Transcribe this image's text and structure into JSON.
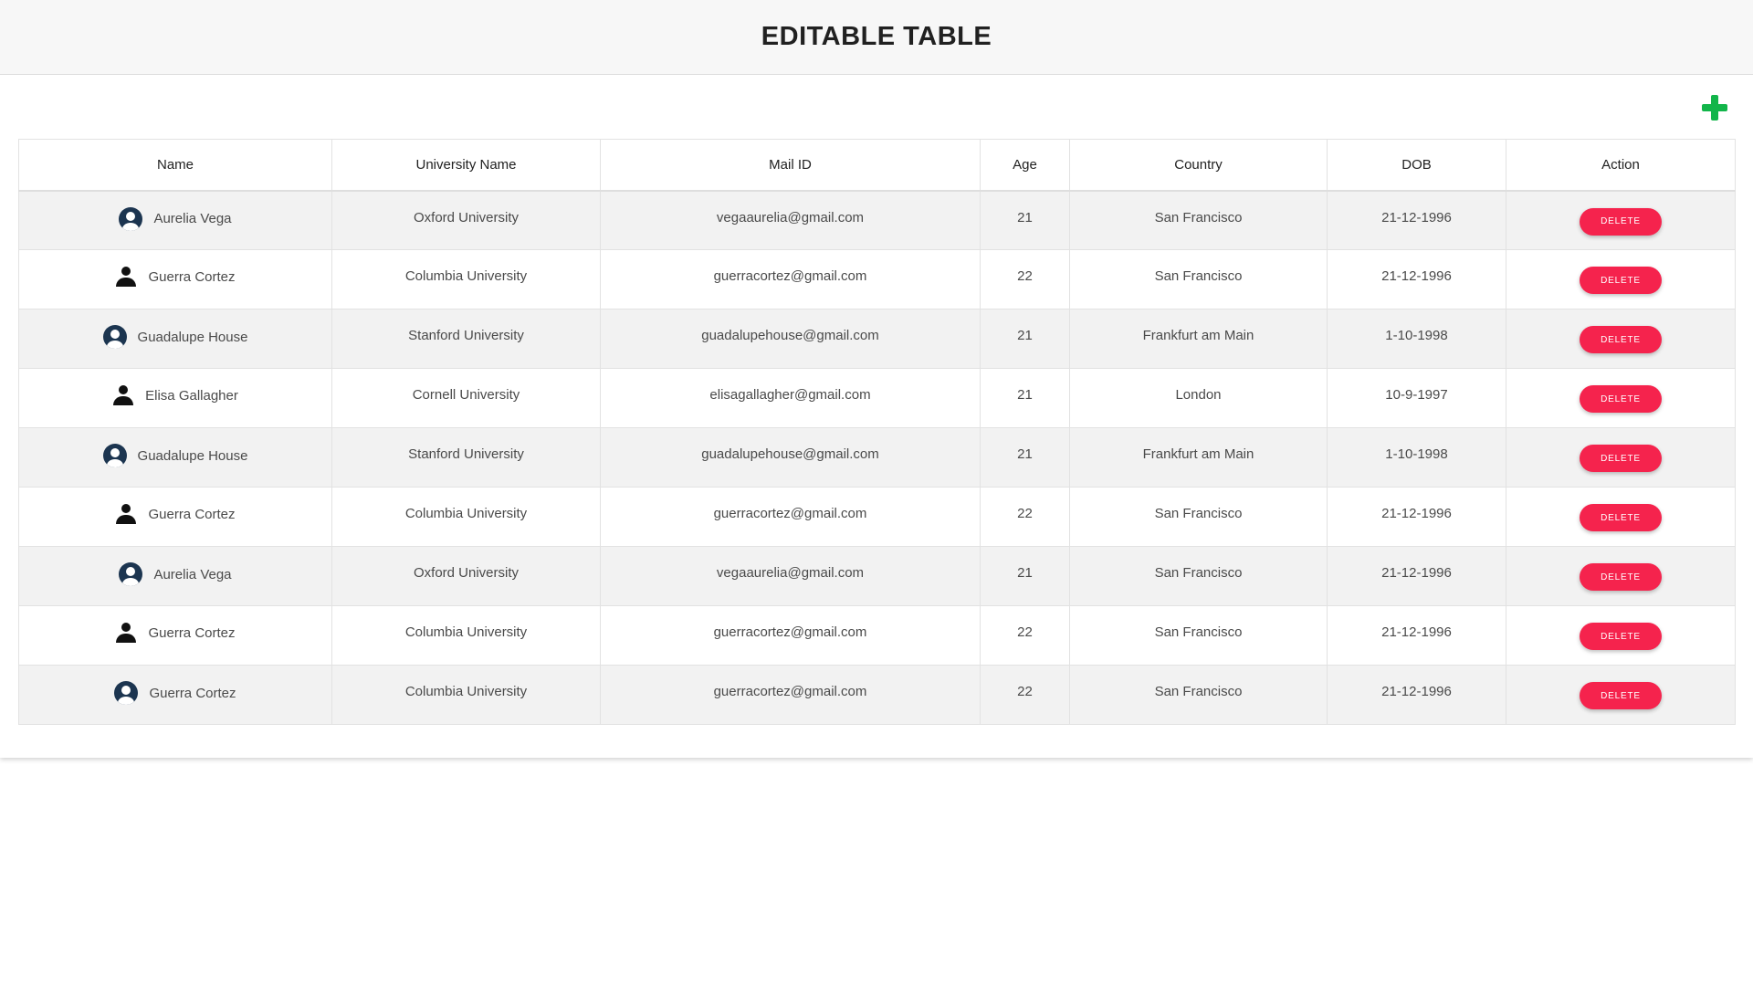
{
  "header": {
    "title": "EDITABLE TABLE"
  },
  "colors": {
    "accent_add": "#12b54a",
    "delete_button": "#f5234d",
    "avatar_dark": "#1c3550"
  },
  "toolbar": {
    "add_icon": "plus-icon"
  },
  "table": {
    "columns": [
      "Name",
      "University Name",
      "Mail ID",
      "Age",
      "Country",
      "DOB",
      "Action"
    ],
    "rows": [
      {
        "avatar": "circle",
        "name": "Aurelia Vega",
        "university": "Oxford University",
        "mail": "vegaaurelia@gmail.com",
        "age": "21",
        "country": "San Francisco",
        "dob": "21-12-1996",
        "action": "DELETE"
      },
      {
        "avatar": "person",
        "name": "Guerra Cortez",
        "university": "Columbia University",
        "mail": "guerracortez@gmail.com",
        "age": "22",
        "country": "San Francisco",
        "dob": "21-12-1996",
        "action": "DELETE"
      },
      {
        "avatar": "circle",
        "name": "Guadalupe House",
        "university": "Stanford University",
        "mail": "guadalupehouse@gmail.com",
        "age": "21",
        "country": "Frankfurt am Main",
        "dob": "1-10-1998",
        "action": "DELETE"
      },
      {
        "avatar": "person",
        "name": "Elisa Gallagher",
        "university": "Cornell University",
        "mail": "elisagallagher@gmail.com",
        "age": "21",
        "country": "London",
        "dob": "10-9-1997",
        "action": "DELETE"
      },
      {
        "avatar": "circle",
        "name": "Guadalupe House",
        "university": "Stanford University",
        "mail": "guadalupehouse@gmail.com",
        "age": "21",
        "country": "Frankfurt am Main",
        "dob": "1-10-1998",
        "action": "DELETE"
      },
      {
        "avatar": "person",
        "name": "Guerra Cortez",
        "university": "Columbia University",
        "mail": "guerracortez@gmail.com",
        "age": "22",
        "country": "San Francisco",
        "dob": "21-12-1996",
        "action": "DELETE"
      },
      {
        "avatar": "circle",
        "name": "Aurelia Vega",
        "university": "Oxford University",
        "mail": "vegaaurelia@gmail.com",
        "age": "21",
        "country": "San Francisco",
        "dob": "21-12-1996",
        "action": "DELETE"
      },
      {
        "avatar": "person",
        "name": "Guerra Cortez",
        "university": "Columbia University",
        "mail": "guerracortez@gmail.com",
        "age": "22",
        "country": "San Francisco",
        "dob": "21-12-1996",
        "action": "DELETE"
      },
      {
        "avatar": "circle",
        "name": "Guerra Cortez",
        "university": "Columbia University",
        "mail": "guerracortez@gmail.com",
        "age": "22",
        "country": "San Francisco",
        "dob": "21-12-1996",
        "action": "DELETE"
      }
    ]
  }
}
